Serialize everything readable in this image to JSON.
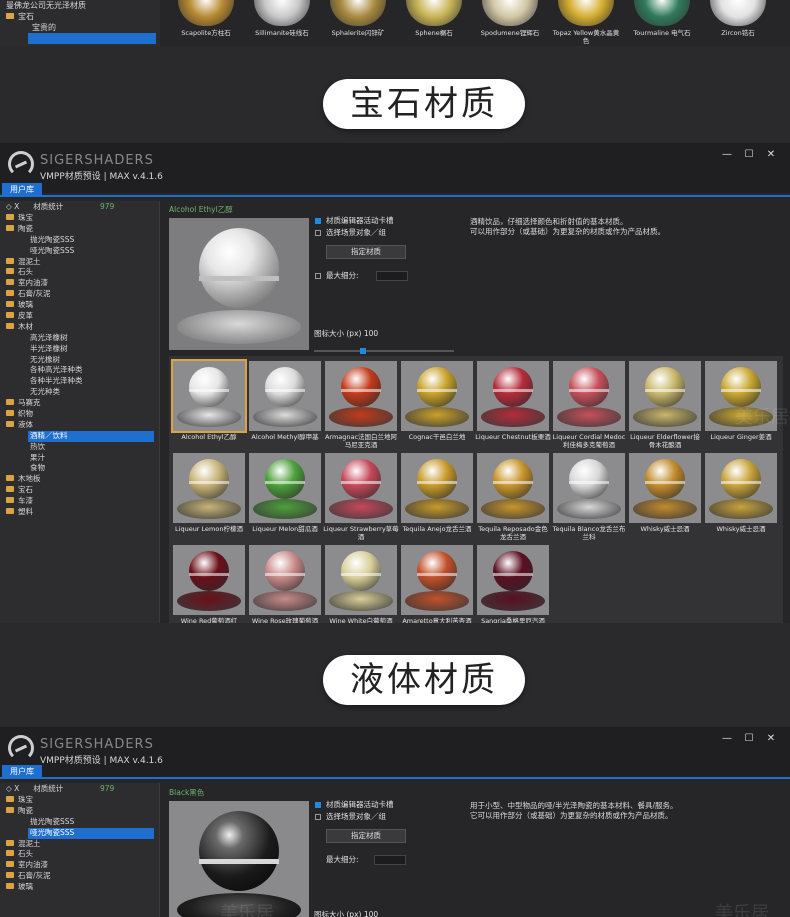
{
  "top_strip": {
    "tree": [
      "曼佛龙公司无光泽材质",
      "宝石",
      "宝贵的",
      ""
    ],
    "thumbs": [
      {
        "label": "Scapolite方柱石",
        "color": "#b7892f"
      },
      {
        "label": "Sillimanite硅线石",
        "color": "#c9c9c9"
      },
      {
        "label": "Sphalerite闪锌矿",
        "color": "#a88a3e"
      },
      {
        "label": "Sphene榍石",
        "color": "#c8b454"
      },
      {
        "label": "Spodumene锂辉石",
        "color": "#d2c7a6"
      },
      {
        "label": "Topaz Yellow黄水晶黄色",
        "color": "#d6ad2f"
      },
      {
        "label": "Tourmaline 电气石",
        "color": "#2f7a5c"
      },
      {
        "label": "Zircon锆石",
        "color": "#e2e2e2"
      }
    ]
  },
  "banners": {
    "gem": "宝石材质",
    "liquid": "液体材质"
  },
  "window1": {
    "brand": "SIGERSHADERS",
    "version": "VMPP材质预设 | MAX v.4.1.6",
    "tab": "用户库",
    "sidebar_tools": "◇ X",
    "sidebar_head": "材质统计",
    "count": "979",
    "tree": [
      {
        "label": "珠宝",
        "kind": "folder"
      },
      {
        "label": "陶瓷",
        "kind": "folder"
      },
      {
        "label": "抛光陶瓷SSS",
        "kind": "sub"
      },
      {
        "label": "哑光陶瓷SSS",
        "kind": "sub"
      },
      {
        "label": "混泥土",
        "kind": "folder"
      },
      {
        "label": "石头",
        "kind": "folder"
      },
      {
        "label": "室内油漆",
        "kind": "folder"
      },
      {
        "label": "石膏/灰泥",
        "kind": "folder"
      },
      {
        "label": "玻璃",
        "kind": "folder"
      },
      {
        "label": "皮革",
        "kind": "folder"
      },
      {
        "label": "木材",
        "kind": "folder"
      },
      {
        "label": "高光泽橡树",
        "kind": "sub"
      },
      {
        "label": "半光泽橡树",
        "kind": "sub"
      },
      {
        "label": "无光橡树",
        "kind": "sub"
      },
      {
        "label": "各种高光泽种类",
        "kind": "sub"
      },
      {
        "label": "各种半光泽种类",
        "kind": "sub"
      },
      {
        "label": "无光种类",
        "kind": "sub"
      },
      {
        "label": "马赛克",
        "kind": "folder"
      },
      {
        "label": "织物",
        "kind": "folder"
      },
      {
        "label": "液体",
        "kind": "folder"
      },
      {
        "label": "酒精／饮料",
        "kind": "sel"
      },
      {
        "label": "热饮",
        "kind": "sub"
      },
      {
        "label": "果汁",
        "kind": "sub"
      },
      {
        "label": "食物",
        "kind": "sub"
      },
      {
        "label": "木地板",
        "kind": "folder"
      },
      {
        "label": "宝石",
        "kind": "folder"
      },
      {
        "label": "车漆",
        "kind": "folder"
      },
      {
        "label": "塑料",
        "kind": "folder"
      }
    ],
    "material_title": "Alcohol Ethyl乙醇",
    "opt_sync": "材质编辑器活动卡槽",
    "opt_select": "选择场景对象／组",
    "assign_button": "指定材质",
    "max_subdiv": "最大细分:",
    "icon_size": "图标大小 (px)    100",
    "description_lines": [
      "酒精饮品，仔细选择颜色和折射值的基本材质。",
      "可以用作部分（或基础）为更复杂的材质或作为产品材质。"
    ],
    "thumbs": [
      {
        "label": "Alcohol Ethyl乙醇",
        "color": "#e6e6e6",
        "selected": true
      },
      {
        "label": "Alcohol Methyl醇甲基",
        "color": "#dcdcdc"
      },
      {
        "label": "Armagnac法国白兰地阿马尼亚克酒",
        "color": "#c43a1a"
      },
      {
        "label": "Cognac干邑白兰地",
        "color": "#c9a22a"
      },
      {
        "label": "Liqueur Chestnut板栗酒",
        "color": "#b52b3a"
      },
      {
        "label": "Liqueur Cordial Medoc利佳梅多克葡萄酒",
        "color": "#c7505a"
      },
      {
        "label": "Liqueur Elderflower接骨木花酿酒",
        "color": "#c9b86a"
      },
      {
        "label": "Liqueur Ginger姜酒",
        "color": "#c9a830"
      },
      {
        "label": "Liqueur Lemon柠檬酒",
        "color": "#c8b478"
      },
      {
        "label": "Liqueur Melon甜瓜酒",
        "color": "#4ca13a"
      },
      {
        "label": "Liqueur Strawberry草莓酒",
        "color": "#c6485a"
      },
      {
        "label": "Tequila Anejo龙舌兰酒",
        "color": "#c79a2a"
      },
      {
        "label": "Tequila Reposado金色龙舌兰酒",
        "color": "#c9952b"
      },
      {
        "label": "Tequila Blanco龙舌兰布兰科",
        "color": "#d8d8d8"
      },
      {
        "label": "Whisky威士忌酒",
        "color": "#c38b2c"
      },
      {
        "label": "Whisky威士忌酒",
        "color": "#c8a33c"
      },
      {
        "label": "Wine Red葡萄酒红",
        "color": "#6a0f1a"
      },
      {
        "label": "Wine Rose玫瑰葡萄酒",
        "color": "#c98a8a"
      },
      {
        "label": "Wine White白葡萄酒",
        "color": "#d9cf9a"
      },
      {
        "label": "Amaretto意大利苦杏酒",
        "color": "#c2502a"
      },
      {
        "label": "Sangria桑格里厄汽酒",
        "color": "#5a0f22"
      }
    ]
  },
  "window2": {
    "brand": "SIGERSHADERS",
    "version": "VMPP材质预设 | MAX v.4.1.6",
    "tab": "用户库",
    "sidebar_tools": "◇ X",
    "sidebar_head": "材质统计",
    "count": "979",
    "tree": [
      {
        "label": "珠宝",
        "kind": "folder"
      },
      {
        "label": "陶瓷",
        "kind": "folder"
      },
      {
        "label": "抛光陶瓷SSS",
        "kind": "sub"
      },
      {
        "label": "哑光陶瓷SSS",
        "kind": "sel"
      },
      {
        "label": "混泥土",
        "kind": "folder"
      },
      {
        "label": "石头",
        "kind": "folder"
      },
      {
        "label": "室内油漆",
        "kind": "folder"
      },
      {
        "label": "石膏/灰泥",
        "kind": "folder"
      },
      {
        "label": "玻璃",
        "kind": "folder"
      }
    ],
    "material_title": "Black黑色",
    "opt_sync": "材质编辑器活动卡槽",
    "opt_select": "选择场景对象／组",
    "assign_button": "指定材质",
    "max_subdiv": "最大细分:",
    "icon_size": "图标大小 (px)    100",
    "description_lines": [
      "用于小型、中型物品的哑/半光泽陶瓷的基本材料、餐具/服务。",
      "它可以用作部分（或基础）为更复杂的材质或作为产品材质。"
    ]
  },
  "watermark": "美乐居"
}
